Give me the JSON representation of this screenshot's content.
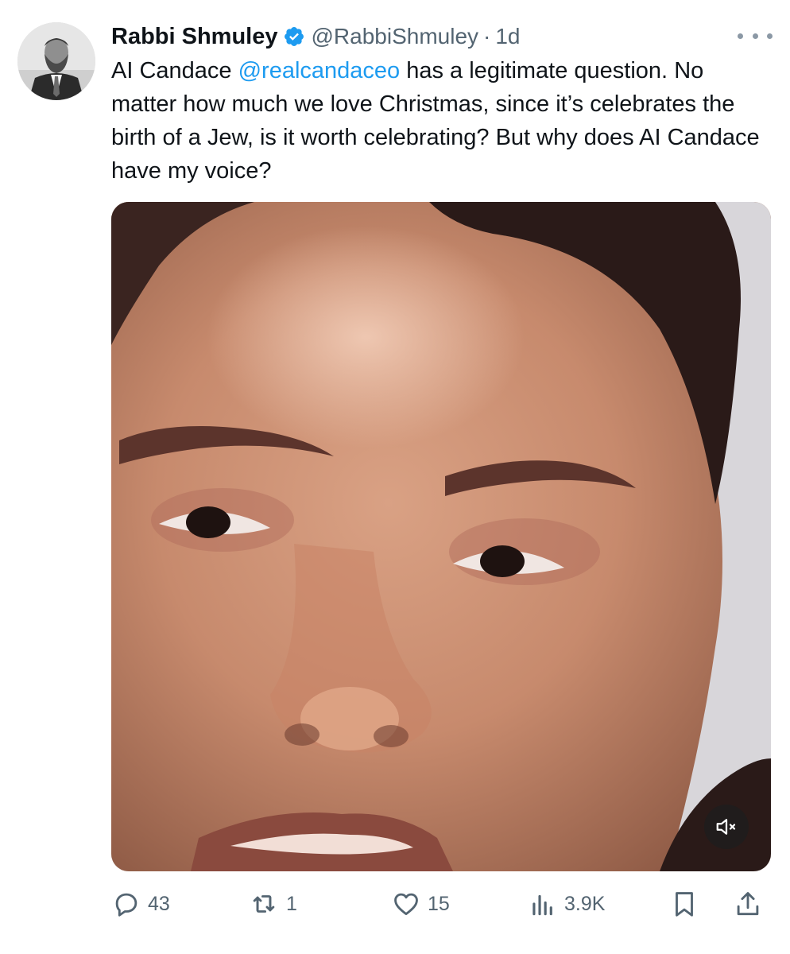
{
  "tweet": {
    "author": {
      "name": "Rabbi Shmuley",
      "handle": "@RabbiShmuley",
      "verified_icon": "verified-badge-icon",
      "separator": "·",
      "time": "1d"
    },
    "text": {
      "line1_before": "AI Candace ",
      "mention": "@realcandaceo",
      "line1_after": " has a legitimate question.",
      "body": "No matter how much we love Christmas, since it’s celebrates the birth of a Jew, is it worth celebrating? But why does AI Candace have my voice?"
    },
    "media": {
      "type": "video",
      "mute_icon": "speaker-muted-icon"
    },
    "actions": {
      "replies": "43",
      "reposts": "1",
      "likes": "15",
      "views": "3.9K"
    }
  },
  "colors": {
    "text": "#0f1419",
    "secondary": "#536471",
    "accent": "#1d9bf0"
  }
}
